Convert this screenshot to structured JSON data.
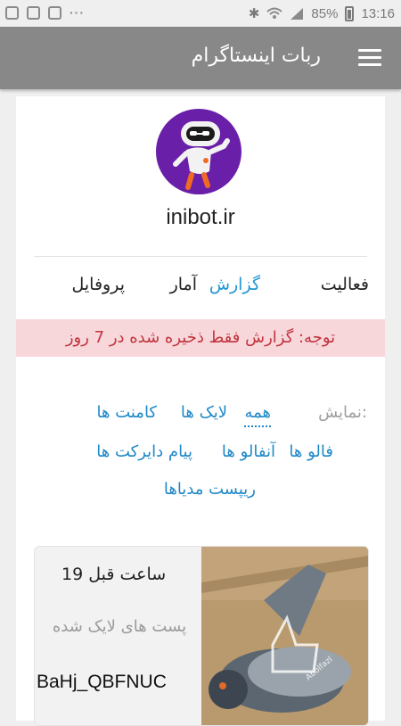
{
  "status_bar": {
    "battery": "85%",
    "time": "13:16"
  },
  "app_bar": {
    "title": "ربات اینستاگرام"
  },
  "profile": {
    "site": "inibot.ir"
  },
  "tabs": [
    {
      "label": "فعالیت"
    },
    {
      "label": "گزارش"
    },
    {
      "label": "آمار"
    },
    {
      "label": "پروفایل"
    }
  ],
  "notice": "توجه: گزارش فقط ذخیره شده در 7 روز",
  "filters": {
    "label": "نمایش:",
    "items": [
      "همه",
      "لایک ها",
      "کامنت ها",
      "فالو ها",
      "آنفالو ها",
      "پیام دایرکت ها",
      "ریپست مدیاها"
    ]
  },
  "activity": {
    "time": "19 ساعت قبل",
    "description": "پست های لایک شده",
    "code": "BaHj_QBFNUC",
    "watermark": "Abolfazl"
  },
  "colors": {
    "accent": "#2196d3",
    "app_bar": "#888888",
    "notice_bg": "#f8d7da",
    "notice_text": "#c0343f"
  }
}
